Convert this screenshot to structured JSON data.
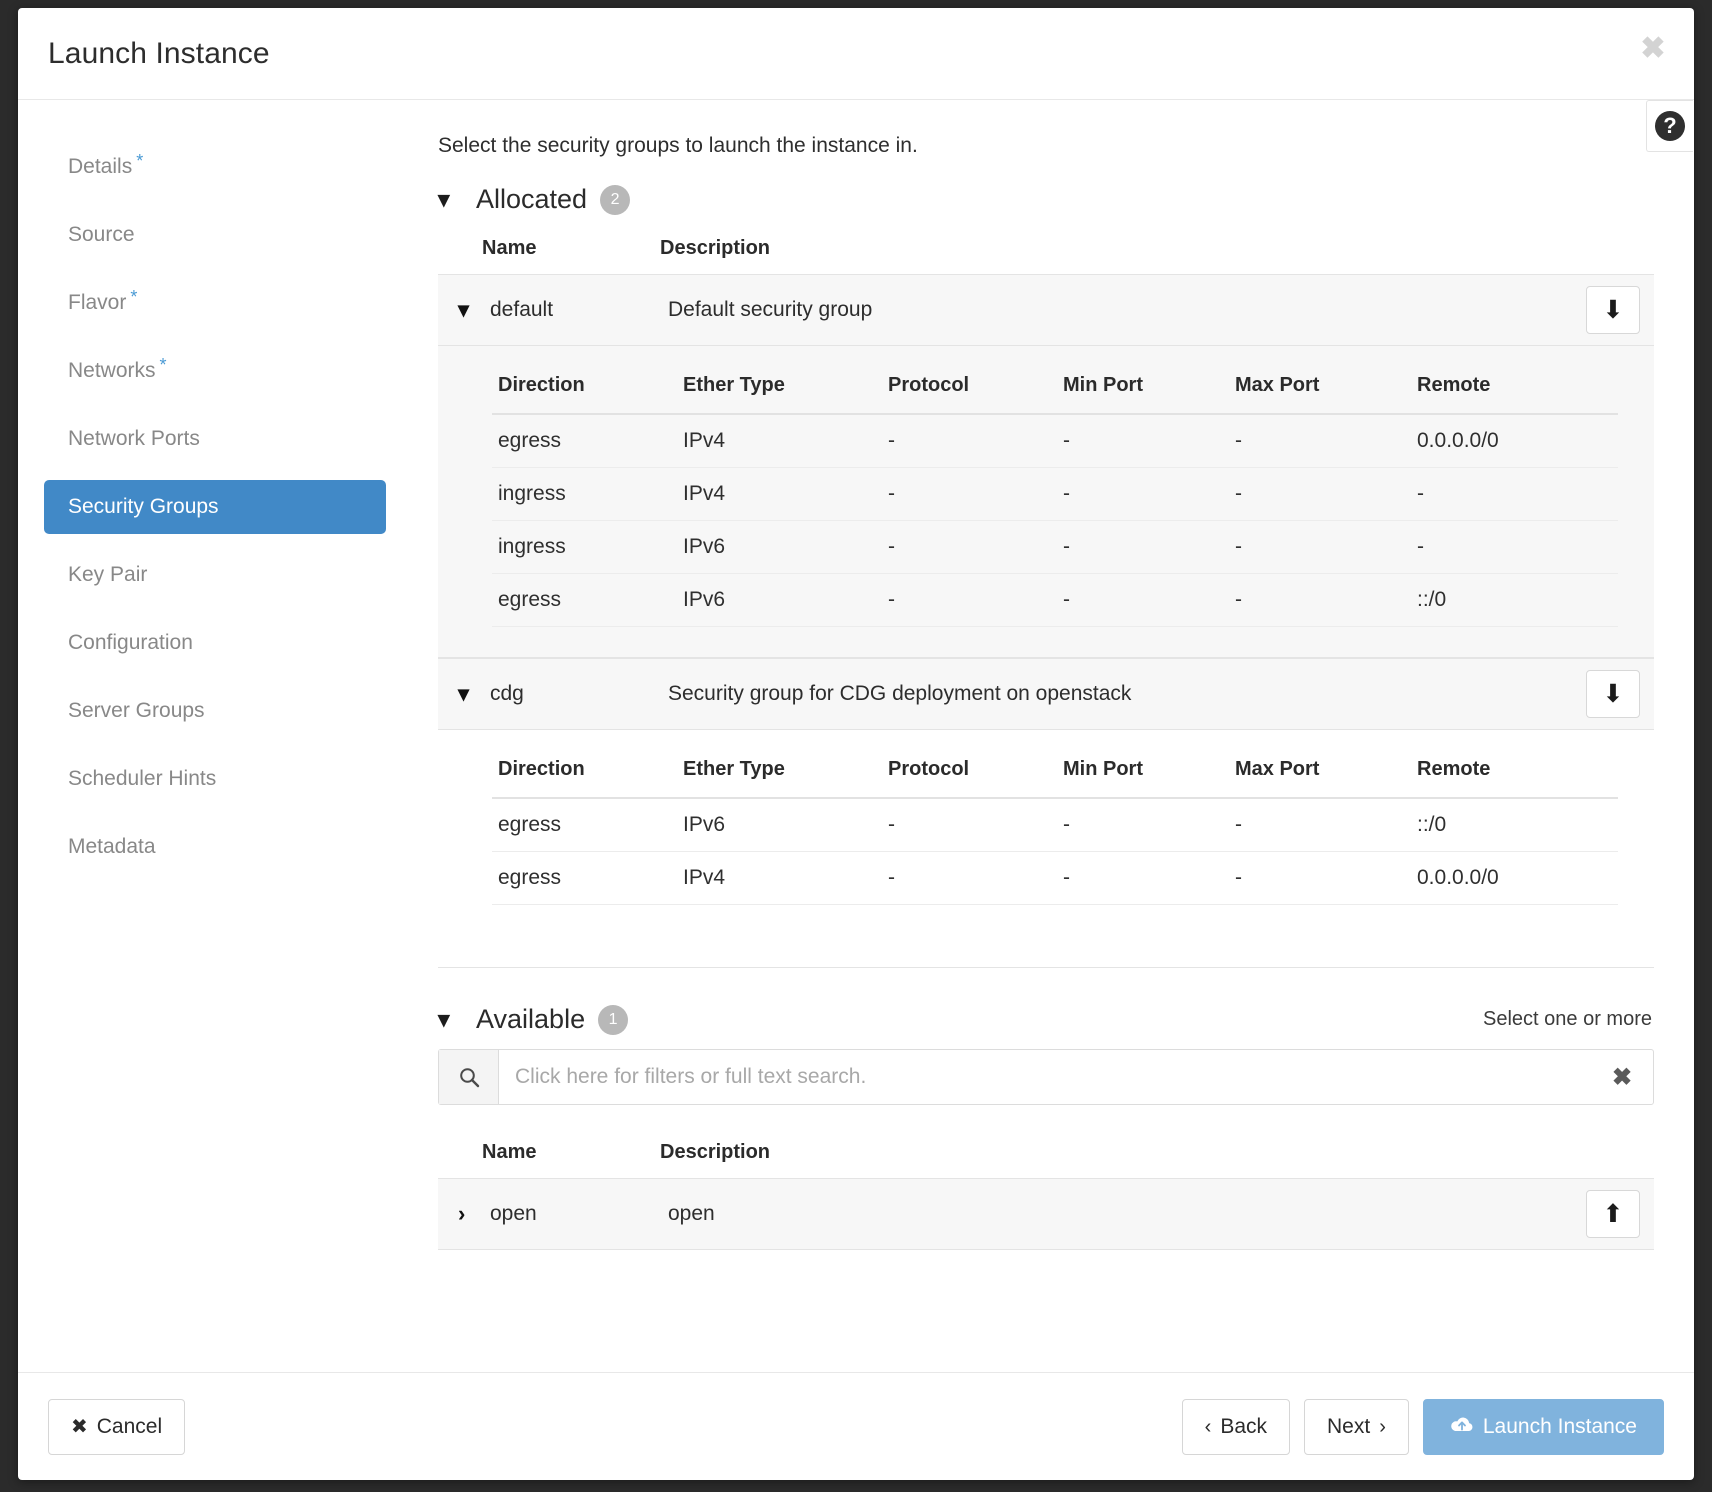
{
  "window": {
    "title": "Launch Instance",
    "close_icon": "close-icon",
    "help_icon": "?"
  },
  "sidebar": {
    "items": [
      {
        "label": "Details",
        "required": true,
        "active": false
      },
      {
        "label": "Source",
        "required": false,
        "active": false
      },
      {
        "label": "Flavor",
        "required": true,
        "active": false
      },
      {
        "label": "Networks",
        "required": true,
        "active": false
      },
      {
        "label": "Network Ports",
        "required": false,
        "active": false
      },
      {
        "label": "Security Groups",
        "required": false,
        "active": true
      },
      {
        "label": "Key Pair",
        "required": false,
        "active": false
      },
      {
        "label": "Configuration",
        "required": false,
        "active": false
      },
      {
        "label": "Server Groups",
        "required": false,
        "active": false
      },
      {
        "label": "Scheduler Hints",
        "required": false,
        "active": false
      },
      {
        "label": "Metadata",
        "required": false,
        "active": false
      }
    ]
  },
  "main": {
    "intro": "Select the security groups to launch the instance in.",
    "allocated": {
      "title": "Allocated",
      "count": "2",
      "columns": {
        "name": "Name",
        "description": "Description"
      },
      "rule_columns": [
        "Direction",
        "Ether Type",
        "Protocol",
        "Min Port",
        "Max Port",
        "Remote"
      ],
      "groups": [
        {
          "name": "default",
          "description": "Default security group",
          "action_icon": "arrow-down-icon",
          "rules": [
            {
              "direction": "egress",
              "ether_type": "IPv4",
              "protocol": "-",
              "min_port": "-",
              "max_port": "-",
              "remote": "0.0.0.0/0"
            },
            {
              "direction": "ingress",
              "ether_type": "IPv4",
              "protocol": "-",
              "min_port": "-",
              "max_port": "-",
              "remote": "-"
            },
            {
              "direction": "ingress",
              "ether_type": "IPv6",
              "protocol": "-",
              "min_port": "-",
              "max_port": "-",
              "remote": "-"
            },
            {
              "direction": "egress",
              "ether_type": "IPv6",
              "protocol": "-",
              "min_port": "-",
              "max_port": "-",
              "remote": "::/0"
            }
          ]
        },
        {
          "name": "cdg",
          "description": "Security group for CDG deployment on openstack",
          "action_icon": "arrow-down-icon",
          "rules": [
            {
              "direction": "egress",
              "ether_type": "IPv6",
              "protocol": "-",
              "min_port": "-",
              "max_port": "-",
              "remote": "::/0"
            },
            {
              "direction": "egress",
              "ether_type": "IPv4",
              "protocol": "-",
              "min_port": "-",
              "max_port": "-",
              "remote": "0.0.0.0/0"
            }
          ]
        }
      ]
    },
    "available": {
      "title": "Available",
      "count": "1",
      "hint": "Select one or more",
      "search": {
        "placeholder": "Click here for filters or full text search.",
        "value": "",
        "icon": "search-icon",
        "clear_icon": "clear-icon"
      },
      "columns": {
        "name": "Name",
        "description": "Description"
      },
      "groups": [
        {
          "name": "open",
          "description": "open",
          "action_icon": "arrow-up-icon"
        }
      ]
    }
  },
  "footer": {
    "cancel": "Cancel",
    "back": "Back",
    "next": "Next",
    "launch": "Launch Instance"
  },
  "colors": {
    "accent": "#4189c7",
    "primary_button": "#80b3dd",
    "required_star": "#4a9ad4",
    "badge": "#b8b8b8"
  }
}
